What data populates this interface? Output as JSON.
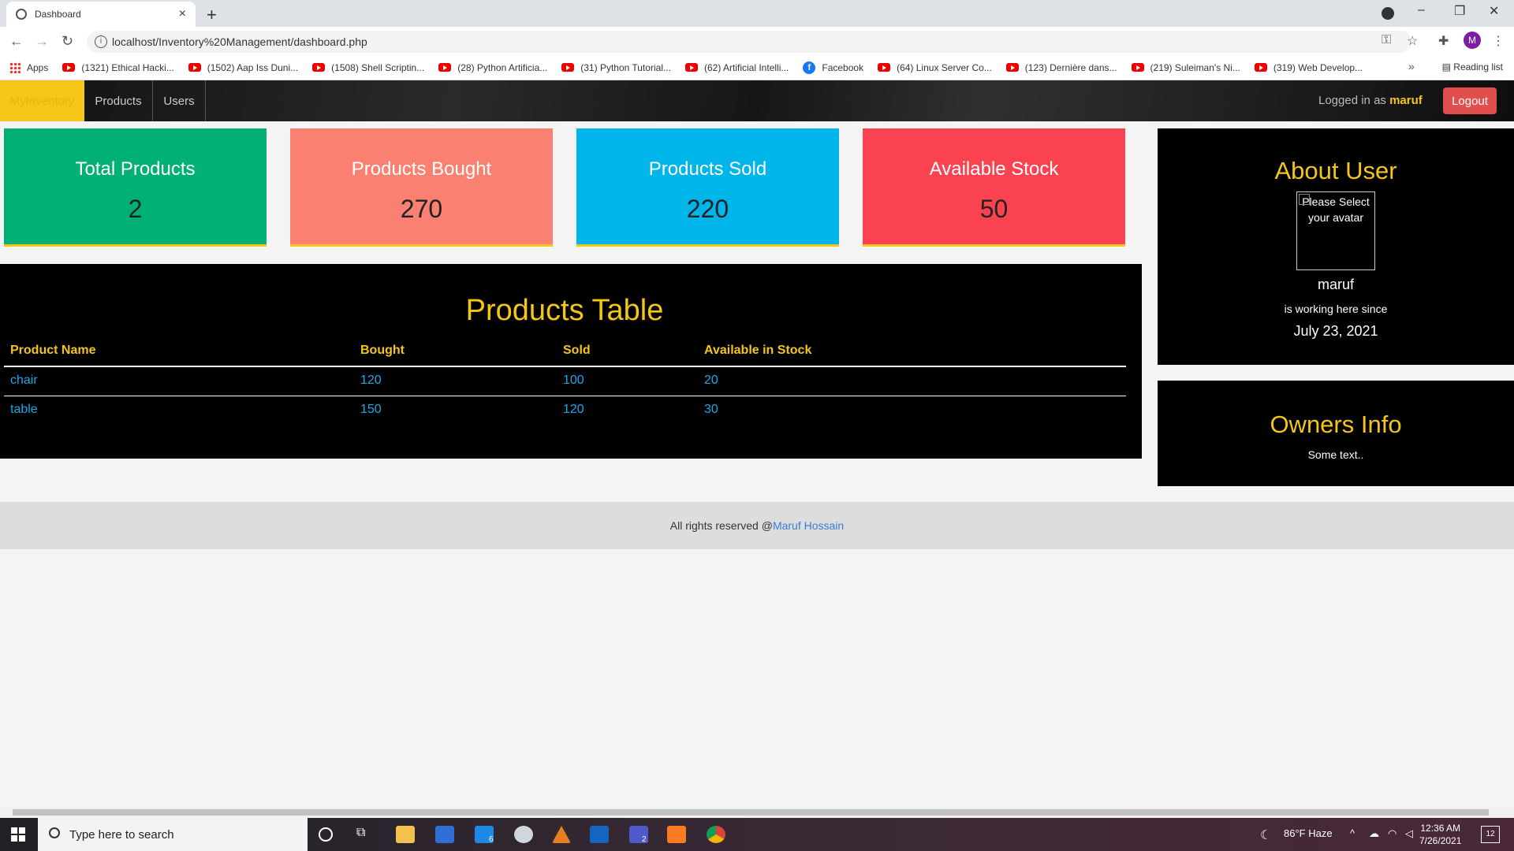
{
  "browser": {
    "tab_title": "Dashboard",
    "new_tab": "+",
    "url": "localhost/Inventory%20Management/dashboard.php",
    "profile_initial": "M",
    "bookmarks": [
      {
        "label": "Apps",
        "icon": "apps-icon"
      },
      {
        "label": "(1321) Ethical Hacki...",
        "icon": "youtube-icon"
      },
      {
        "label": "(1502) Aap Iss Duni...",
        "icon": "youtube-icon"
      },
      {
        "label": "(1508) Shell Scriptin...",
        "icon": "youtube-icon"
      },
      {
        "label": "(28) Python Artificia...",
        "icon": "youtube-icon"
      },
      {
        "label": "(31) Python Tutorial...",
        "icon": "youtube-icon"
      },
      {
        "label": "(62) Artificial Intelli...",
        "icon": "youtube-icon"
      },
      {
        "label": "Facebook",
        "icon": "facebook-icon"
      },
      {
        "label": "(64) Linux Server Co...",
        "icon": "youtube-icon"
      },
      {
        "label": "(123) Dernière dans...",
        "icon": "youtube-icon"
      },
      {
        "label": "(219) Suleiman's Ni...",
        "icon": "youtube-icon"
      },
      {
        "label": "(319) Web Develop...",
        "icon": "youtube-icon"
      }
    ],
    "reading_list": "Reading list",
    "more": "»"
  },
  "nav": {
    "brand": "MyInventory",
    "links": [
      "Products",
      "Users"
    ],
    "logged_prefix": "Logged in as",
    "username": "maruf",
    "logout": "Logout"
  },
  "cards": [
    {
      "title": "Total Products",
      "value": "2",
      "color": "#00b074"
    },
    {
      "title": "Products Bought",
      "value": "270",
      "color": "#fa8072"
    },
    {
      "title": "Products Sold",
      "value": "220",
      "color": "#00b5e9"
    },
    {
      "title": "Available Stock",
      "value": "50",
      "color": "#fa4251"
    }
  ],
  "products_table": {
    "title": "Products Table",
    "headers": [
      "Product Name",
      "Bought",
      "Sold",
      "Available in Stock"
    ],
    "rows": [
      [
        "chair",
        "120",
        "100",
        "20"
      ],
      [
        "table",
        "150",
        "120",
        "30"
      ]
    ]
  },
  "about": {
    "title": "About User",
    "avatar_alt": "Please Select your avatar",
    "name": "maruf",
    "since_label": "is working here since",
    "date": "July 23, 2021"
  },
  "owners": {
    "title": "Owners Info",
    "text": "Some text.."
  },
  "footer": {
    "text": "All rights reserved @",
    "link": "Maruf Hossain"
  },
  "taskbar": {
    "search_placeholder": "Type here to search",
    "weather": "86°F  Haze",
    "time": "12:36 AM",
    "date": "7/26/2021",
    "mail_badge": "6",
    "teams_badge": "2",
    "notif_count": "12"
  }
}
